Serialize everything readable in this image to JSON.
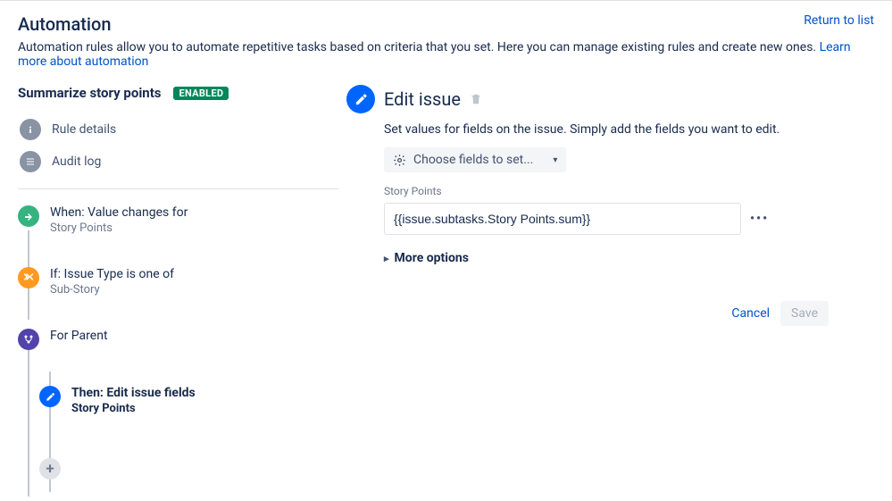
{
  "header": {
    "title": "Automation",
    "return": "Return to list",
    "subhead": "Automation rules allow you to automate repetitive tasks based on criteria that you set. Here you can manage existing rules and create new ones. ",
    "learn_more": "Learn more about automation"
  },
  "rule": {
    "name": "Summarize story points",
    "status": "ENABLED"
  },
  "sidebar": {
    "rule_details": "Rule details",
    "audit_log": "Audit log"
  },
  "steps": {
    "trigger": {
      "title": "When: Value changes for",
      "detail": "Story Points"
    },
    "condition": {
      "title": "If: Issue Type is one of",
      "detail": "Sub-Story"
    },
    "branch": {
      "title": "For Parent"
    },
    "action": {
      "title": "Then: Edit issue fields",
      "detail": "Story Points"
    }
  },
  "panel": {
    "title": "Edit issue",
    "description": "Set values for fields on the issue. Simply add the fields you want to edit.",
    "chooser_label": "Choose fields to set...",
    "field_label": "Story Points",
    "field_value": "{{issue.subtasks.Story Points.sum}}",
    "more_options": "More options",
    "cancel": "Cancel",
    "save": "Save"
  }
}
